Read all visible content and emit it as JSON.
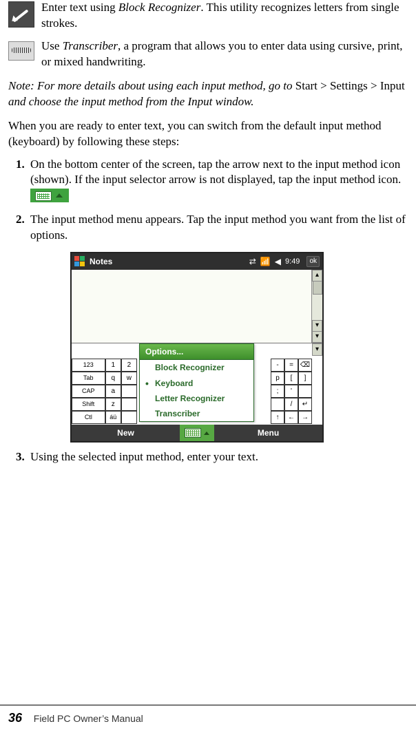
{
  "bullets": {
    "block": {
      "pre": "Enter text using ",
      "em": "Block Recognizer",
      "post": ". This utility recognizes letters from single strokes."
    },
    "trans": {
      "pre": "Use ",
      "em": "Transcriber",
      "post": ", a program that allows you to enter data using cursive, print, or mixed handwriting."
    }
  },
  "note": {
    "pre": "Note: For more details about using each input method, go to ",
    "path": "Start > Settings > Input",
    "post": " and choose the input method from the Input window."
  },
  "lead": "When you are ready to enter text, you can switch from the default input method (keyboard) by following these steps:",
  "steps": {
    "s1": "On the bottom center of the screen, tap the arrow next to the input method icon (shown). If the input selector arrow is not displayed, tap the input method icon.",
    "s2": "The input method menu appears. Tap the input method you want from the list of options.",
    "s3": "Using the selected input method, enter your text."
  },
  "device": {
    "title": "Notes",
    "time": "9:49",
    "ok": "ok",
    "popup": {
      "head": "Options...",
      "items": [
        "Block Recognizer",
        "Keyboard",
        "Letter Recognizer",
        "Transcriber"
      ],
      "selected_index": 1
    },
    "softbar": {
      "left": "New",
      "right": "Menu"
    },
    "kbd_left": [
      [
        "123",
        "1",
        "2"
      ],
      [
        "Tab",
        "q",
        "w"
      ],
      [
        "CAP",
        "a",
        ""
      ],
      [
        "Shift",
        "z",
        ""
      ],
      [
        "Ctl",
        "áü",
        ""
      ]
    ],
    "kbd_right": [
      [
        "-",
        "=",
        "⌫"
      ],
      [
        "p",
        "[",
        "]"
      ],
      [
        ";",
        "'",
        ""
      ],
      [
        "",
        "/",
        "↵"
      ],
      [
        "↑",
        "←",
        "→"
      ]
    ],
    "scroll": {
      "up": "▴",
      "down": "▾"
    }
  },
  "footer": {
    "page": "36",
    "title": "Field PC Owner’s Manual"
  }
}
